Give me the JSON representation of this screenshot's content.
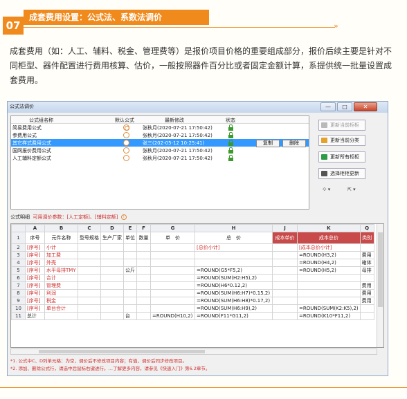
{
  "section": {
    "number": "07",
    "title": "成套费用设置：公式法、系数法调价",
    "arrow": "»"
  },
  "intro": "成套费用（如：人工、辅料、税金、管理费等）是报价项目价格的重要组成部分，报价后续主要是针对不同柜型、器件配置进行费用核算、估价，一般按照器件百分比或者固定金额计算，系提供统一批量设置成套费用。",
  "window": {
    "title": "公式法调价",
    "buttons": [
      "—",
      "□",
      "✕"
    ]
  },
  "list": {
    "headers": [
      "公式组名称",
      "默认公式",
      "最新修改",
      "状态"
    ],
    "rows": [
      {
        "name": "简易费用公式",
        "default": true,
        "modified": "张秋月(2020-07-21 17:50:42)",
        "selected": false
      },
      {
        "name": "参费用公式",
        "default": false,
        "modified": "张秋月(2020-07-21 17:50:42)",
        "selected": false
      },
      {
        "name": "其它样式费用公式",
        "default": false,
        "modified": "张三(202-05-12 10:25:41)",
        "selected": true
      },
      {
        "name": "国网报价费用公式",
        "default": false,
        "modified": "张秋月(2020-07-21 17:50:42)",
        "selected": false
      },
      {
        "name": "人工辅料定额公式",
        "default": false,
        "modified": "张秋月(2020-07-21 17:50:42)",
        "selected": false
      }
    ],
    "row_buttons": [
      "复制",
      "删除"
    ]
  },
  "side_buttons": [
    {
      "label": "更新当前柜柜",
      "icon_color": "#b9b9b9",
      "disabled": true
    },
    {
      "label": "更新当前分类",
      "icon_color": "#e3a22a",
      "disabled": false
    },
    {
      "label": "更新所有柜柜",
      "icon_color": "#2f9a48",
      "disabled": false
    },
    {
      "label": "选择柜柜更新",
      "icon_color": "#555555",
      "disabled": false
    }
  ],
  "dropdowns": [
    "⟐ ▾",
    "⇱ ▾"
  ],
  "detail": {
    "label": "公式明细",
    "hint": "可用调价参数：[人工定额]、[辅料定额]",
    "info": "!"
  },
  "sheet": {
    "col_headers": [
      "",
      "A",
      "B",
      "C",
      "D",
      "E",
      "F",
      "G",
      "H",
      "J",
      "K",
      "Q"
    ],
    "header_row": [
      "1",
      "序号",
      "元件名称",
      "型号规格",
      "生产厂家",
      "单位",
      "数量",
      "单　价",
      "总　价",
      "成本单价",
      "成本总价",
      "类别"
    ],
    "rows": [
      [
        "2",
        "[序号]",
        "小计",
        "",
        "",
        "",
        "",
        "",
        "[总价小计]",
        "",
        "[成本总价小计]",
        ""
      ],
      [
        "3",
        "[序号]",
        "加工费",
        "",
        "",
        "",
        "",
        "",
        "",
        "",
        "=ROUND(H3,2)",
        "费用"
      ],
      [
        "4",
        "[序号]",
        "外壳",
        "",
        "",
        "",
        "",
        "",
        "",
        "",
        "=ROUND(H4,2)",
        "箱体"
      ],
      [
        "5",
        "[序号]",
        "水平母排TMY",
        "",
        "",
        "公斤",
        "",
        "",
        "=ROUND(G5*F5,2)",
        "",
        "=ROUND(H5,2)",
        "母排"
      ],
      [
        "6",
        "[序号]",
        "合计",
        "",
        "",
        "",
        "",
        "",
        "=ROUND(SUM(H2:H5),2)",
        "",
        "",
        ""
      ],
      [
        "7",
        "[序号]",
        "管理费",
        "",
        "",
        "",
        "",
        "",
        "=ROUND(H6*0.12,2)",
        "",
        "",
        "费用"
      ],
      [
        "8",
        "[序号]",
        "利润",
        "",
        "",
        "",
        "",
        "",
        "=ROUND(SUM(H6:H7)*0.15,2)",
        "",
        "",
        "费用"
      ],
      [
        "9",
        "[序号]",
        "税金",
        "",
        "",
        "",
        "",
        "",
        "=ROUND(SUM(H6:H8)*0.17,2)",
        "",
        "",
        "费用"
      ],
      [
        "10",
        "[序号]",
        "单台合计",
        "",
        "",
        "",
        "",
        "",
        "=ROUND(SUM(H6:H9),2)",
        "",
        "=ROUND(SUM(K2:K5),2)",
        ""
      ],
      [
        "11",
        "总计",
        "",
        "",
        "",
        "台",
        "",
        "=ROUND(H10,2)",
        "=ROUND(F11*G11,2)",
        "",
        "=ROUND(K10*F11,2)",
        ""
      ]
    ]
  },
  "notes": [
    "*1. 公式中C、D列单元格：为空，调价后不修改项目内容；有值，调价后同步修改项目。",
    "*2. 添加、删除公式行，请选中后鼠标右键进行。…了解更多内容，请参见《快速入门》第6.2章节。"
  ]
}
